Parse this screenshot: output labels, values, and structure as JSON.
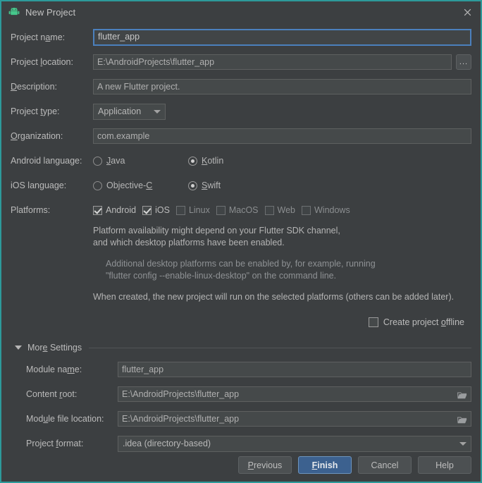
{
  "window": {
    "title": "New Project",
    "icon": "android-robot-icon",
    "close_label": "×",
    "border_color": "#2d9a9a",
    "background": "#3c3f41"
  },
  "form": {
    "project_name": {
      "label_pre": "Project n",
      "label_mnemonic": "a",
      "label_post": "me:",
      "value": "flutter_app",
      "focused": true
    },
    "project_location": {
      "label_pre": "Project ",
      "label_mnemonic": "l",
      "label_post": "ocation:",
      "value": "E:\\AndroidProjects\\flutter_app",
      "browse_label": "..."
    },
    "description": {
      "label_pre": "",
      "label_mnemonic": "D",
      "label_post": "escription:",
      "value": "A new Flutter project."
    },
    "project_type": {
      "label_pre": "Project ",
      "label_mnemonic": "t",
      "label_post": "ype:",
      "value": "Application"
    },
    "organization": {
      "label_pre": "",
      "label_mnemonic": "O",
      "label_post": "rganization:",
      "value": "com.example"
    },
    "android_language": {
      "label": "Android language:",
      "options": [
        {
          "label_pre": "",
          "label_mnemonic": "J",
          "label_post": "ava",
          "selected": false
        },
        {
          "label_pre": "",
          "label_mnemonic": "K",
          "label_post": "otlin",
          "selected": true
        }
      ]
    },
    "ios_language": {
      "label": "iOS language:",
      "options": [
        {
          "label_pre": "Objective-",
          "label_mnemonic": "C",
          "label_post": "",
          "selected": false
        },
        {
          "label_pre": "",
          "label_mnemonic": "S",
          "label_post": "wift",
          "selected": true
        }
      ]
    },
    "platforms": {
      "label": "Platforms:",
      "options": [
        {
          "label": "Android",
          "checked": true,
          "enabled": true
        },
        {
          "label": "iOS",
          "checked": true,
          "enabled": true
        },
        {
          "label": "Linux",
          "checked": false,
          "enabled": false
        },
        {
          "label": "MacOS",
          "checked": false,
          "enabled": false
        },
        {
          "label": "Web",
          "checked": false,
          "enabled": false
        },
        {
          "label": "Windows",
          "checked": false,
          "enabled": false
        }
      ]
    }
  },
  "info": {
    "line1": "Platform availability might depend on your Flutter SDK channel,",
    "line2": "and which desktop platforms have been enabled.",
    "line3": "Additional desktop platforms can be enabled by, for example, running",
    "line4": "\"flutter config --enable-linux-desktop\" on the command line.",
    "line5": "When created, the new project will run on the selected platforms (others can be added later)."
  },
  "offline": {
    "label_pre": "Create project ",
    "label_mnemonic": "o",
    "label_post": "ffline",
    "checked": false
  },
  "more_settings": {
    "title_pre": "Mor",
    "title_mnemonic": "e",
    "title_post": " Settings",
    "expanded": true,
    "module_name": {
      "label_pre": "Module na",
      "label_mnemonic": "m",
      "label_post": "e:",
      "value": "flutter_app"
    },
    "content_root": {
      "label_pre": "Content ",
      "label_mnemonic": "r",
      "label_post": "oot:",
      "value": "E:\\AndroidProjects\\flutter_app",
      "icon": "folder-icon"
    },
    "module_file_location": {
      "label_pre": "Mod",
      "label_mnemonic": "u",
      "label_post": "le file location:",
      "value": "E:\\AndroidProjects\\flutter_app",
      "icon": "folder-icon"
    },
    "project_format": {
      "label_pre": "Project ",
      "label_mnemonic": "f",
      "label_post": "ormat:",
      "value": ".idea (directory-based)"
    }
  },
  "buttons": {
    "previous": {
      "pre": "",
      "mnemonic": "P",
      "post": "revious"
    },
    "finish": {
      "pre": "",
      "mnemonic": "F",
      "post": "inish",
      "primary": true,
      "accent": "#3c618f"
    },
    "cancel": {
      "pre": "",
      "mnemonic": "",
      "post": "Cancel"
    },
    "help": {
      "pre": "",
      "mnemonic": "",
      "post": "Help"
    }
  }
}
